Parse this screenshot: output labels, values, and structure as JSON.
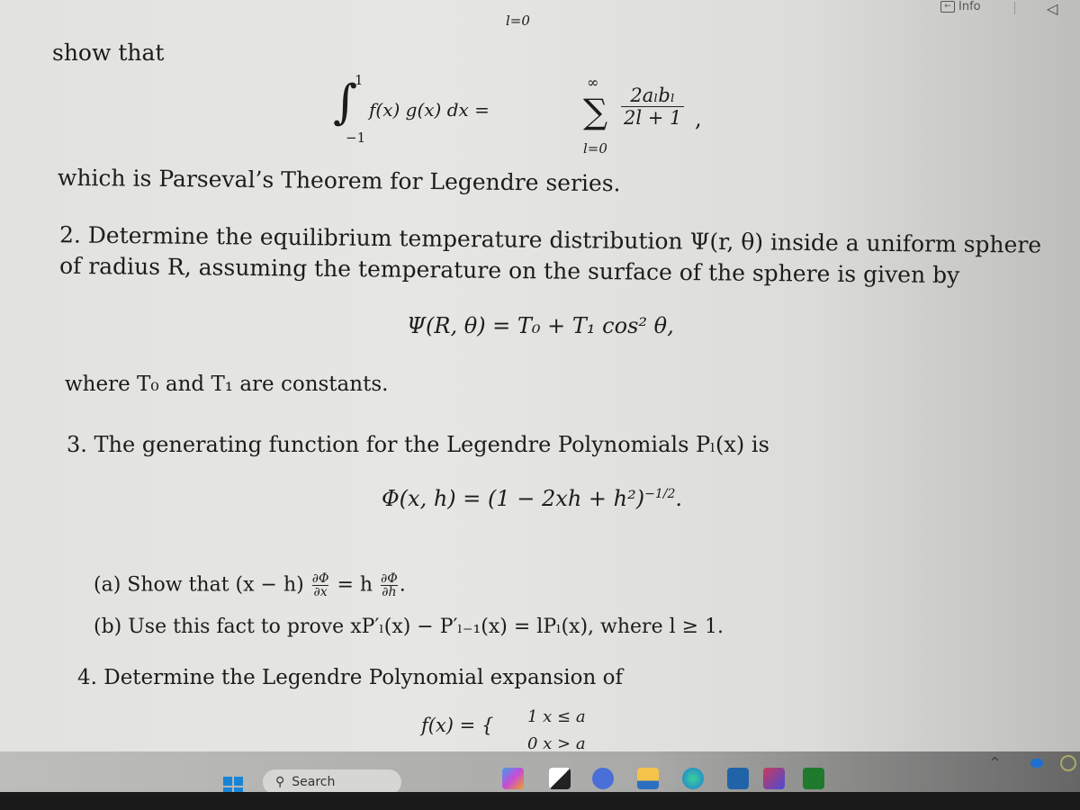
{
  "topbar": {
    "info_label": "Info",
    "info_icon": "panel-arrow-icon",
    "collapse_icon": "collapse-left-icon"
  },
  "document": {
    "top_sum_index": "l=0",
    "show_that": "show that",
    "parseval": {
      "integral_upper": "1",
      "integral_lower": "−1",
      "integrand": "f(x) g(x) dx =",
      "sum_upper": "∞",
      "sum_lower": "l=0",
      "numerator": "2aₗbₗ",
      "denominator": "2l + 1",
      "trail": ","
    },
    "parseval_caption": "which is Parseval’s Theorem for Legendre series.",
    "problem2": {
      "line1": "2. Determine the equilibrium temperature distribution Ψ(r, θ) inside a uniform sphere",
      "line2": "of radius R, assuming the temperature on the surface of the sphere is given by",
      "equation": "Ψ(R, θ) = T₀ + T₁ cos² θ,",
      "where": "where T₀ and T₁ are constants."
    },
    "problem3": {
      "line1": "3. The generating function for the Legendre Polynomials Pₗ(x) is",
      "equation": "Φ(x, h) = (1 − 2xh + h²)",
      "exponent": "−1/2",
      "eq_trail": ".",
      "part_a_prefix": "(a) Show that (x − h)",
      "part_a_frac1_n": "∂Φ",
      "part_a_frac1_d": "∂x",
      "part_a_mid": "= h",
      "part_a_frac2_n": "∂Φ",
      "part_a_frac2_d": "∂h",
      "part_a_trail": ".",
      "part_b": "(b) Use this fact to prove xP′ₗ(x) − P′ₗ₋₁(x) = lPₗ(x), where l ≥ 1."
    },
    "problem4": {
      "line1": "4. Determine the Legendre Polynomial expansion of",
      "equation_lhs": "f(x) = {",
      "case1": "1   x ≤ a",
      "case2": "0   x > a"
    }
  },
  "taskbar": {
    "search_placeholder": "Search",
    "apps": [
      "copilot-app",
      "task-view",
      "chat-app",
      "file-explorer",
      "edge-browser",
      "microsoft-store",
      "media-app",
      "xbox-app"
    ],
    "tray": [
      "chevron-up-icon",
      "onedrive-icon",
      "colorful-app-icon"
    ]
  }
}
